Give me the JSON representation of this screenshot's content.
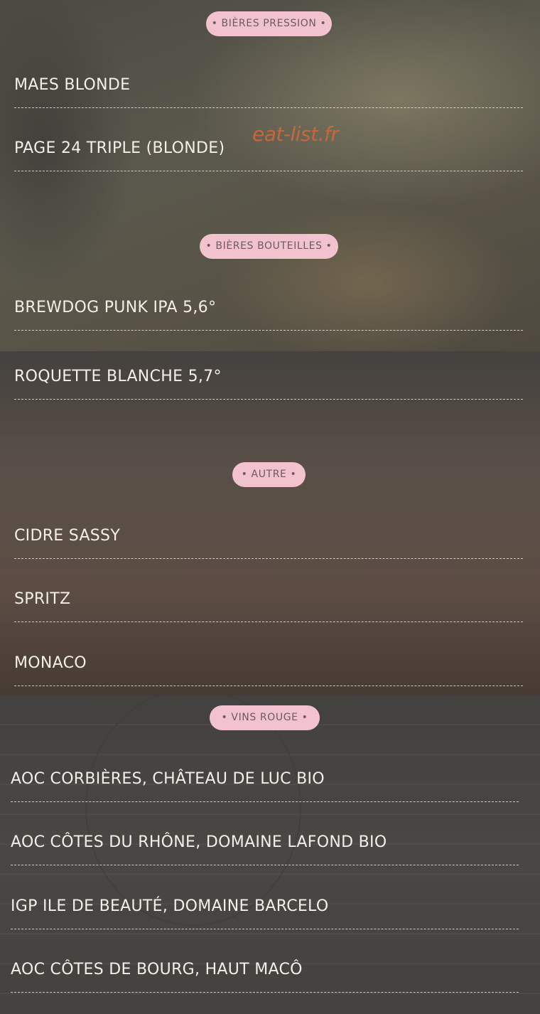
{
  "watermark": "eat-list.fr",
  "sections": [
    {
      "title": "• BIÈRES PRESSION •",
      "items": [
        "MAES BLONDE",
        "PAGE 24 TRIPLE (BLONDE)"
      ]
    },
    {
      "title": "• BIÈRES BOUTEILLES •",
      "items": [
        "BREWDOG PUNK IPA 5,6°",
        "ROQUETTE BLANCHE 5,7°"
      ]
    },
    {
      "title": "• AUTRE •",
      "items": [
        "CIDRE SASSY",
        "SPRITZ",
        "MONACO"
      ]
    },
    {
      "title": "• VINS ROUGE •",
      "items": [
        "AOC CORBIÈRES, CHÂTEAU DE LUC BIO",
        "AOC CÔTES DU RHÔNE, DOMAINE LAFOND BIO",
        "IGP ILE DE BEAUTÉ, DOMAINE BARCELO",
        "AOC CÔTES DE BOURG, HAUT MACÔ"
      ]
    }
  ]
}
